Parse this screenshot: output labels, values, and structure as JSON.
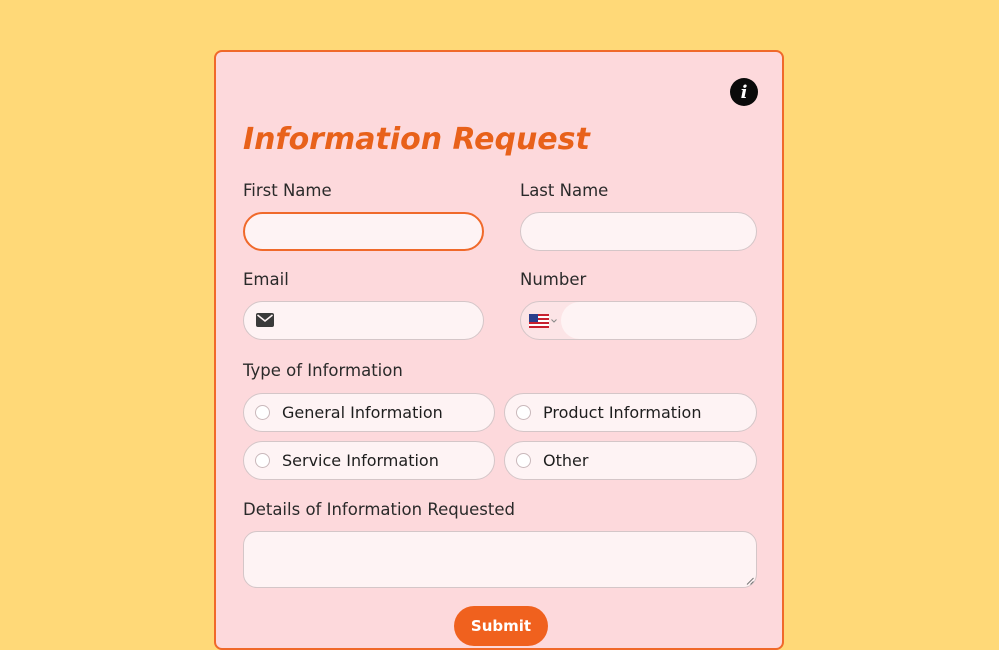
{
  "form": {
    "title": "Information Request",
    "info_icon_glyph": "i",
    "first_name": {
      "label": "First Name",
      "value": "",
      "placeholder": ""
    },
    "last_name": {
      "label": "Last Name",
      "value": "",
      "placeholder": ""
    },
    "email": {
      "label": "Email",
      "value": "",
      "placeholder": "",
      "icon": "envelope-icon"
    },
    "number": {
      "label": "Number",
      "value": "",
      "placeholder": "",
      "country_flag": "us-flag-icon"
    },
    "type_of_information": {
      "label": "Type of Information",
      "options": [
        {
          "label": "General Information",
          "selected": false
        },
        {
          "label": "Product Information",
          "selected": false
        },
        {
          "label": "Service Information",
          "selected": false
        },
        {
          "label": "Other",
          "selected": false
        }
      ]
    },
    "details": {
      "label": "Details of Information Requested",
      "value": "",
      "placeholder": ""
    },
    "submit_label": "Submit"
  },
  "colors": {
    "page_background": "#FFD978",
    "card_background": "#FDD9DC",
    "accent": "#F0692A",
    "title": "#E8611A",
    "submit": "#F0611E"
  }
}
